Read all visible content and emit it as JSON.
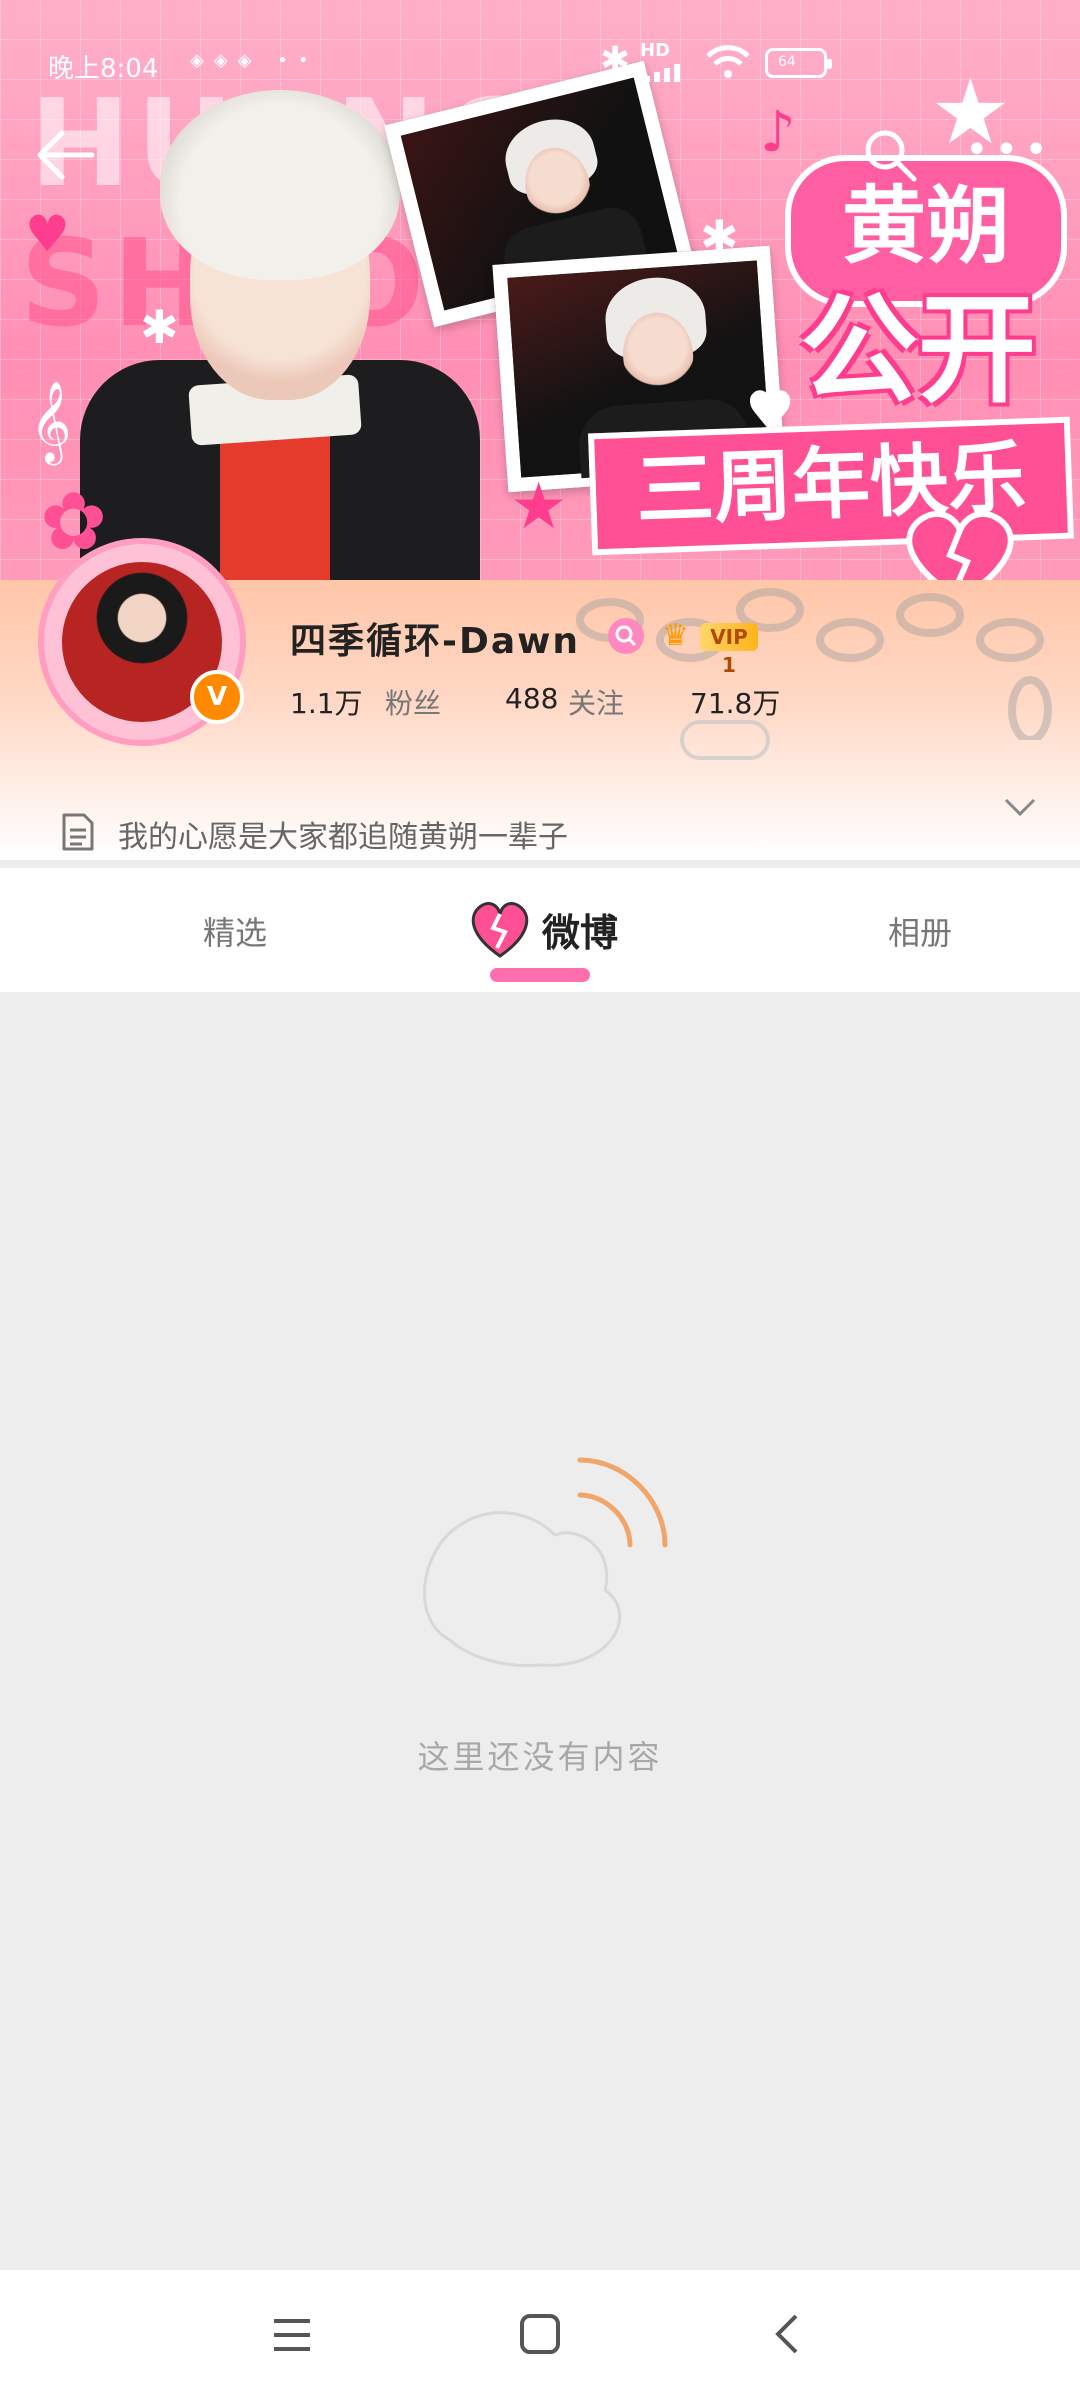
{
  "status_bar": {
    "time": "晚上8:04",
    "network": "HD",
    "battery": "64"
  },
  "banner": {
    "bg_word_1": "HUANG",
    "bg_word_2": "SHUO",
    "tag_name": "黄朔",
    "headline": "公开",
    "subline": "三周年快乐"
  },
  "profile": {
    "name": "四季循环-Dawn",
    "vip_label": "VIP 1",
    "verified_badge": "V",
    "stats": [
      {
        "value": "1.1万",
        "label": "粉丝"
      },
      {
        "value": "488",
        "label": "关注"
      },
      {
        "value": "71.8万",
        "label": ""
      }
    ],
    "bio": "我的心愿是大家都追随黄朔一辈子"
  },
  "tabs": [
    {
      "label": "精选"
    },
    {
      "label": "微博"
    },
    {
      "label": "相册"
    }
  ],
  "empty_state": {
    "message": "这里还没有内容"
  },
  "icons": {
    "back": "back-arrow-icon",
    "search": "search-icon",
    "more": "more-icon",
    "bio": "document-icon",
    "expand": "chevron-down-icon"
  },
  "colors": {
    "brand_pink": "#ff5fa2",
    "badge_orange": "#ff8a00",
    "weibo_orange": "#f0a56a"
  }
}
